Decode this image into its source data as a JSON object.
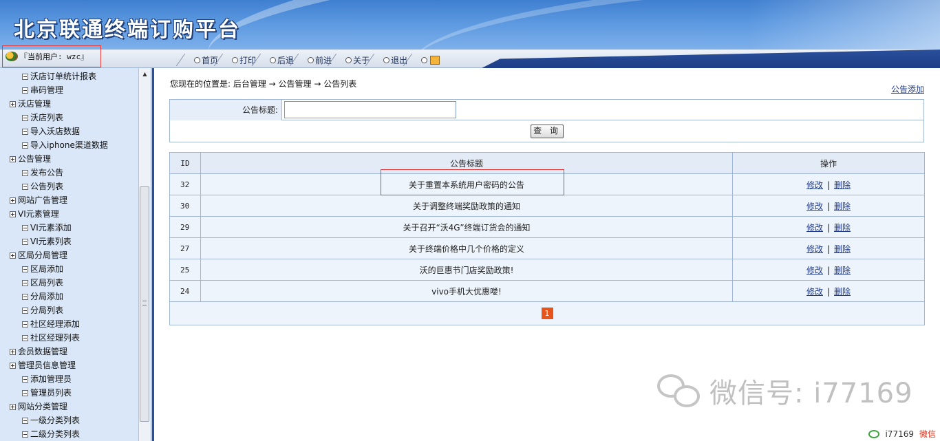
{
  "header": {
    "title": "北京联通终端订购平台"
  },
  "user": {
    "label": "『当前用户: wzc』"
  },
  "nav": {
    "items": [
      "首页",
      "打印",
      "后退",
      "前进",
      "关于",
      "退出"
    ]
  },
  "sidebar": {
    "items": [
      {
        "label": "沃店订单统计报表",
        "level": 1
      },
      {
        "label": "串码管理",
        "level": 1
      },
      {
        "label": "沃店管理",
        "level": 0
      },
      {
        "label": "沃店列表",
        "level": 1
      },
      {
        "label": "导入沃店数据",
        "level": 1
      },
      {
        "label": "导入iphone渠道数据",
        "level": 1
      },
      {
        "label": "公告管理",
        "level": 0
      },
      {
        "label": "发布公告",
        "level": 1
      },
      {
        "label": "公告列表",
        "level": 1
      },
      {
        "label": "网站广告管理",
        "level": 0
      },
      {
        "label": "VI元素管理",
        "level": 0
      },
      {
        "label": "VI元素添加",
        "level": 1
      },
      {
        "label": "VI元素列表",
        "level": 1
      },
      {
        "label": "区局分局管理",
        "level": 0
      },
      {
        "label": "区局添加",
        "level": 1
      },
      {
        "label": "区局列表",
        "level": 1
      },
      {
        "label": "分局添加",
        "level": 1
      },
      {
        "label": "分局列表",
        "level": 1
      },
      {
        "label": "社区经理添加",
        "level": 1
      },
      {
        "label": "社区经理列表",
        "level": 1
      },
      {
        "label": "会员数据管理",
        "level": 0
      },
      {
        "label": "管理员信息管理",
        "level": 0
      },
      {
        "label": "添加管理员",
        "level": 1
      },
      {
        "label": "管理员列表",
        "level": 1
      },
      {
        "label": "网站分类管理",
        "level": 0
      },
      {
        "label": "一级分类列表",
        "level": 1
      },
      {
        "label": "二级分类列表",
        "level": 1
      }
    ]
  },
  "breadcrumb": {
    "text": "您现在的位置是: 后台管理 → 公告管理 → 公告列表"
  },
  "actions": {
    "add_label": "公告添加"
  },
  "search": {
    "label": "公告标题:",
    "value": "",
    "button_label": "查 询"
  },
  "table": {
    "headers": {
      "id": "ID",
      "title": "公告标题",
      "op": "操作"
    },
    "rows": [
      {
        "id": "32",
        "title": "关于重置本系统用户密码的公告",
        "edit": "修改",
        "delete": "删除"
      },
      {
        "id": "30",
        "title": "关于调整终端奖励政策的通知",
        "edit": "修改",
        "delete": "删除"
      },
      {
        "id": "29",
        "title": "关于召开“沃4G”终端订货会的通知",
        "edit": "修改",
        "delete": "删除"
      },
      {
        "id": "27",
        "title": "关于终端价格中几个价格的定义",
        "edit": "修改",
        "delete": "删除"
      },
      {
        "id": "25",
        "title": "沃的巨惠节门店奖励政策!",
        "edit": "修改",
        "delete": "删除"
      },
      {
        "id": "24",
        "title": "vivo手机大优惠喽!",
        "edit": "修改",
        "delete": "删除"
      }
    ],
    "separator": "|"
  },
  "pager": {
    "current": "1"
  },
  "watermark": {
    "main": "微信号: i77169",
    "id": "i77169",
    "brand": "微信"
  },
  "colors": {
    "header_blue": "#3f7fd0",
    "sidebar_bg": "#d9e7f8",
    "table_border": "#9fb6d6",
    "pager_active": "#e6541b",
    "highlight_red": "#e23a3a"
  }
}
